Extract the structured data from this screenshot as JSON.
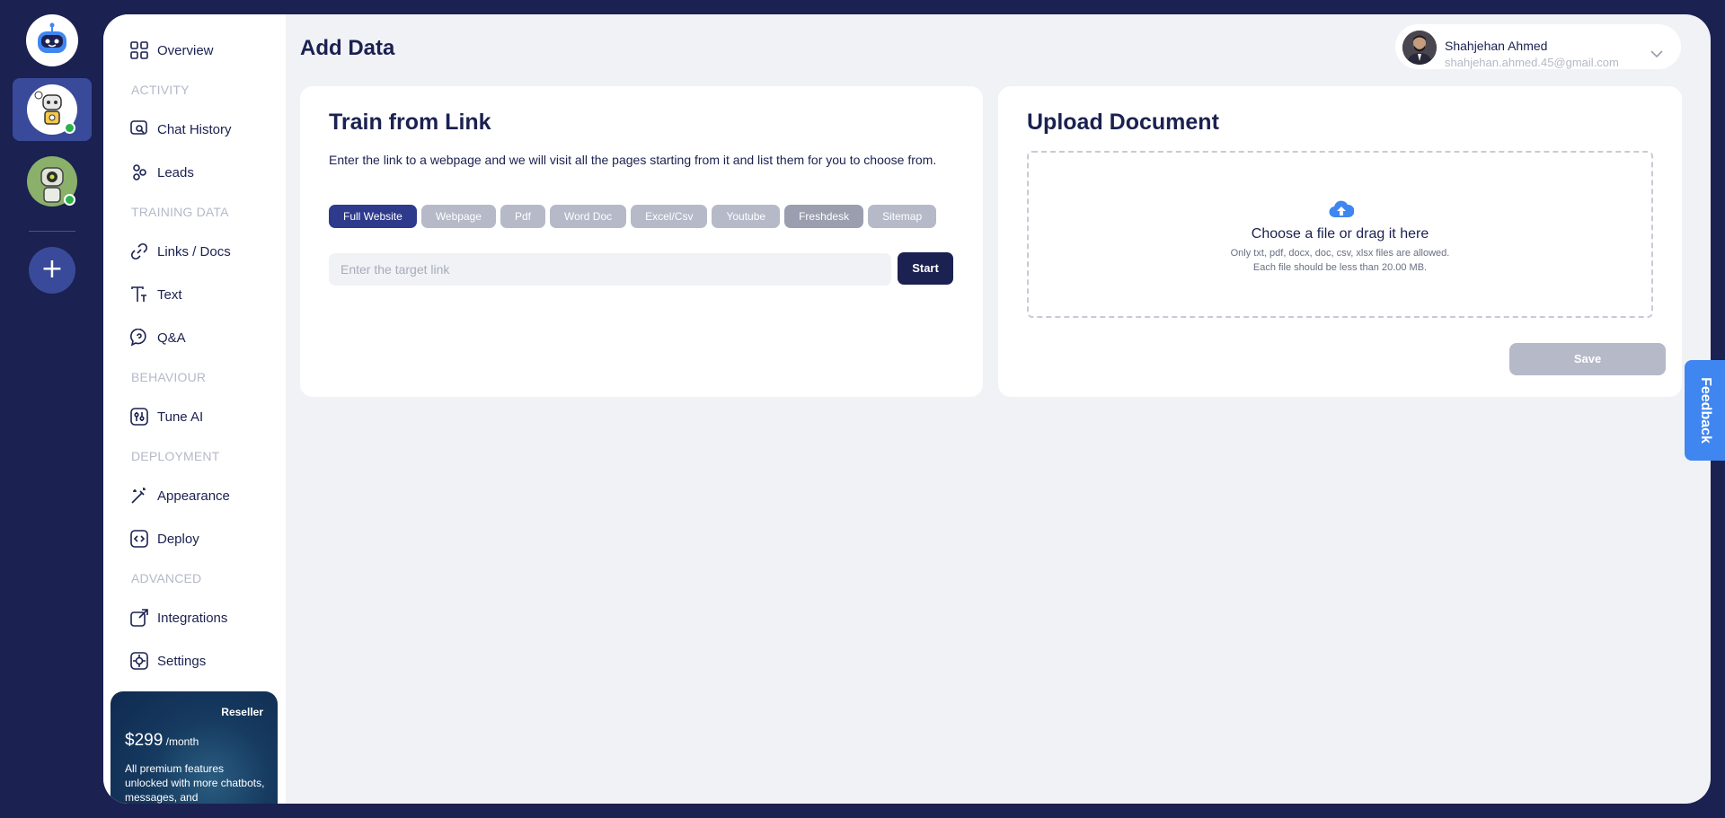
{
  "rail": {
    "add_label": "+"
  },
  "sidebar": {
    "overview": "Overview",
    "section_activity": "ACTIVITY",
    "chat_history": "Chat History",
    "leads": "Leads",
    "section_training": "TRAINING DATA",
    "links_docs": "Links / Docs",
    "text": "Text",
    "qa": "Q&A",
    "section_behaviour": "BEHAVIOUR",
    "tune_ai": "Tune AI",
    "section_deployment": "DEPLOYMENT",
    "appearance": "Appearance",
    "deploy": "Deploy",
    "section_advanced": "ADVANCED",
    "integrations": "Integrations",
    "settings": "Settings"
  },
  "promo": {
    "tag": "Reseller",
    "price": "$299",
    "period": " /month",
    "description": "All premium features unlocked with more chatbots, messages, and"
  },
  "header": {
    "title": "Add Data",
    "user_name": "Shahjehan Ahmed",
    "user_email": "shahjehan.ahmed.45@gmail.com"
  },
  "train_link": {
    "title": "Train from Link",
    "description": "Enter the link to a webpage and we will visit all the pages starting from it and list them for you to choose from.",
    "chips": [
      "Full Website",
      "Webpage",
      "Pdf",
      "Word Doc",
      "Excel/Csv",
      "Youtube",
      "Freshdesk",
      "Sitemap"
    ],
    "input_placeholder": "Enter the target link",
    "input_value": "",
    "start_label": "Start"
  },
  "upload": {
    "title": "Upload Document",
    "drop_title": "Choose a file or drag it here",
    "drop_sub1": "Only txt, pdf, docx, doc, csv, xlsx files are allowed.",
    "drop_sub2": "Each file should be less than 20.00 MB.",
    "save_label": "Save"
  },
  "feedback_label": "Feedback",
  "colors": {
    "navy": "#1b2150",
    "accent": "#2e3a8c",
    "feedback": "#3f86f0",
    "upload_icon": "#3f86f0",
    "online": "#2bb24a"
  },
  "icons": {
    "logo": "robot-logo-icon",
    "upload": "cloud-upload-icon",
    "caret": "chevron-down-icon"
  }
}
